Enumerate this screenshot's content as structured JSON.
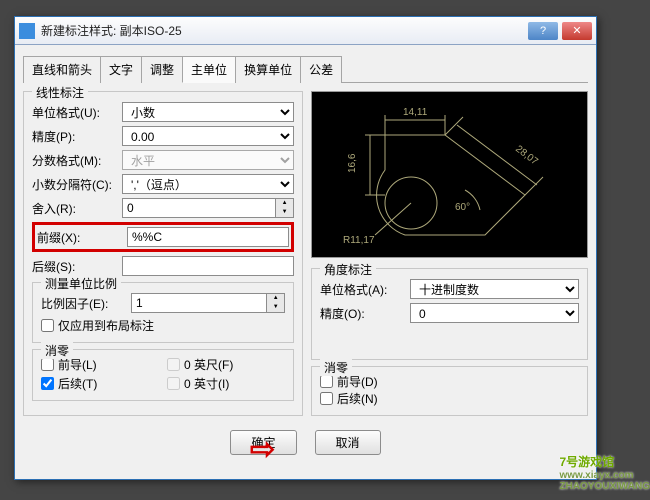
{
  "window": {
    "title": "新建标注样式: 副本ISO-25"
  },
  "tabs": [
    "直线和箭头",
    "文字",
    "调整",
    "主单位",
    "换算单位",
    "公差"
  ],
  "active_tab": 3,
  "linear": {
    "legend": "线性标注",
    "unit_format": {
      "label": "单位格式(U):",
      "value": "小数"
    },
    "precision": {
      "label": "精度(P):",
      "value": "0.00"
    },
    "fraction_format": {
      "label": "分数格式(M):",
      "value": "水平"
    },
    "decimal_sep": {
      "label": "小数分隔符(C):",
      "value": "','（逗点）"
    },
    "round": {
      "label": "舍入(R):",
      "value": "0"
    },
    "prefix": {
      "label": "前缀(X):",
      "value": "%%C"
    },
    "suffix": {
      "label": "后缀(S):",
      "value": ""
    }
  },
  "scale": {
    "legend": "测量单位比例",
    "factor": {
      "label": "比例因子(E):",
      "value": "1"
    },
    "layout_only": {
      "label": "仅应用到布局标注"
    }
  },
  "zero_l": {
    "legend": "消零",
    "leading": "前导(L)",
    "trailing": "后续(T)",
    "feet": "0 英尺(F)",
    "inch": "0 英寸(I)"
  },
  "preview": {
    "dim1": "14,11",
    "dim2": "16,6",
    "dim3": "28,07",
    "dim4": "R11,17",
    "ang": "60°"
  },
  "angular": {
    "legend": "角度标注",
    "unit_format": {
      "label": "单位格式(A):",
      "value": "十进制度数"
    },
    "precision": {
      "label": "精度(O):",
      "value": "0"
    }
  },
  "zero_r": {
    "legend": "消零",
    "leading": "前导(D)",
    "trailing": "后续(N)"
  },
  "buttons": {
    "ok": "确定",
    "cancel": "取消"
  },
  "watermark": {
    "line1": "7号游戏馆",
    "line2": "ZHAOYOUXIWANG",
    "url": "www.xiayx.com"
  }
}
